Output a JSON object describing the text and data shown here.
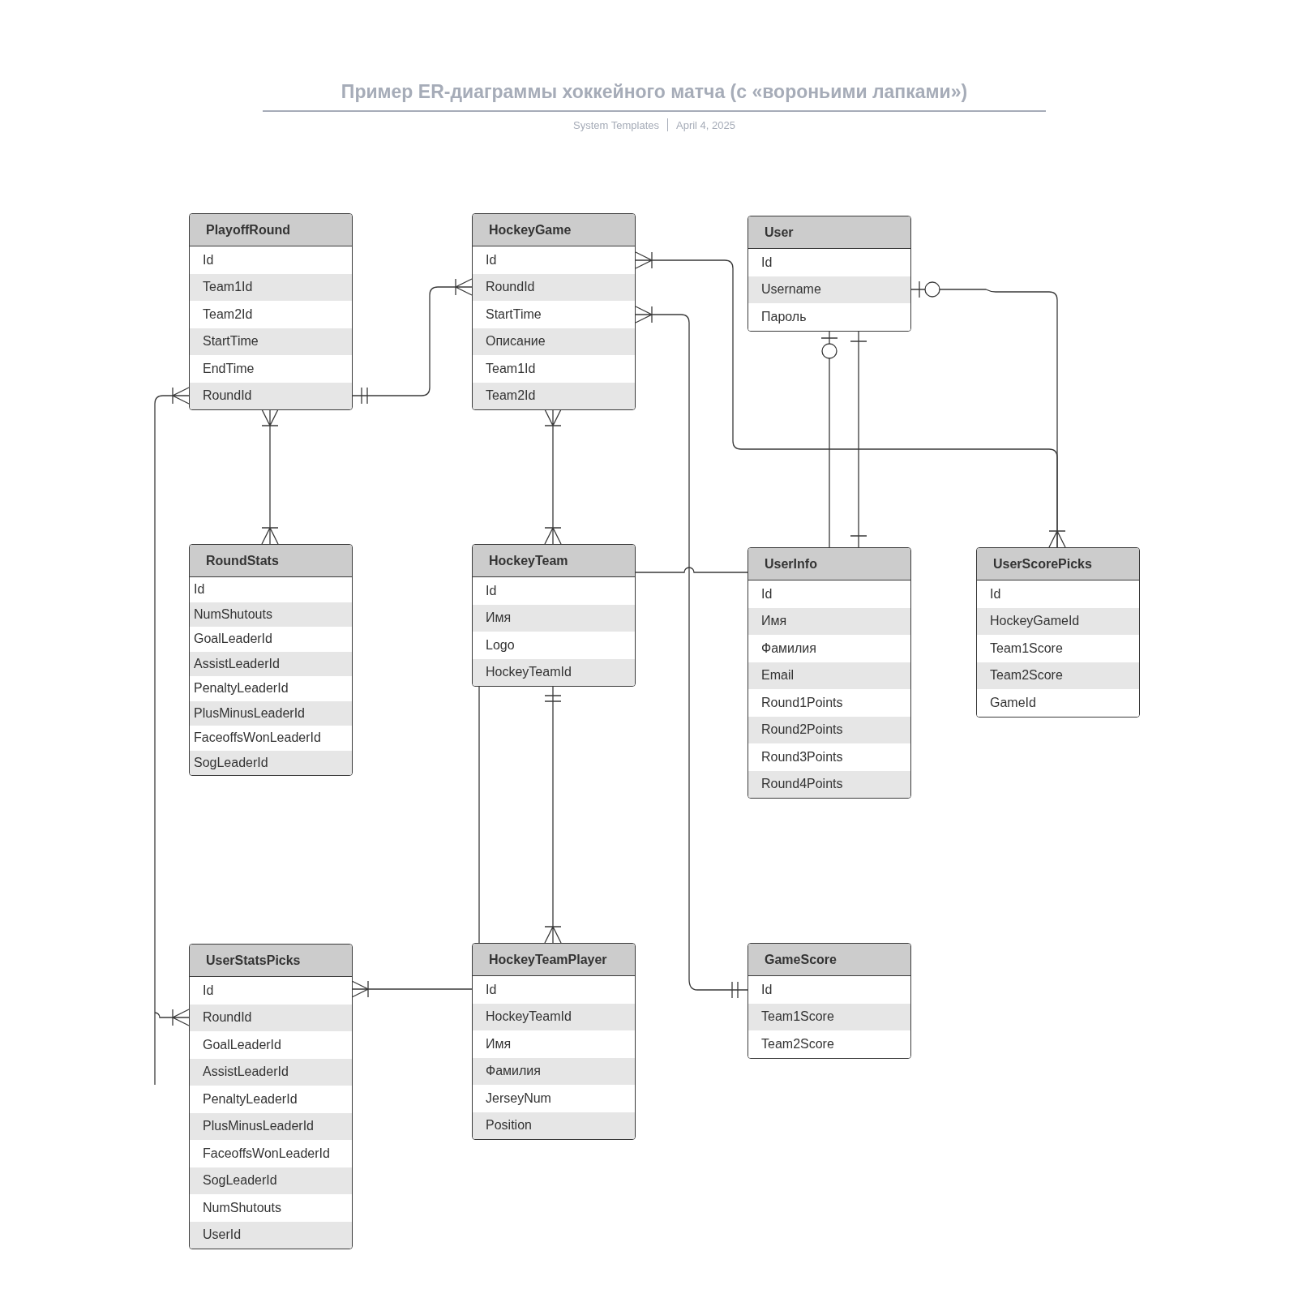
{
  "title": "Пример ER-диаграммы хоккейного матча (с «вороньими лапками»)",
  "subtitle": {
    "author": "System Templates",
    "date": "April 4, 2025"
  },
  "entities": [
    {
      "name": "PlayoffRound",
      "fields": [
        "Id",
        "Team1Id",
        "Team2Id",
        "StartTime",
        "EndTime",
        "RoundId"
      ]
    },
    {
      "name": "HockeyGame",
      "fields": [
        "Id",
        "RoundId",
        "StartTime",
        "Описание",
        "Team1Id",
        "Team2Id"
      ]
    },
    {
      "name": "User",
      "fields": [
        "Id",
        "Username",
        "Пароль"
      ]
    },
    {
      "name": "RoundStats",
      "fields": [
        "Id",
        "NumShutouts",
        "GoalLeaderId",
        "AssistLeaderId",
        "PenaltyLeaderId",
        "PlusMinusLeaderId",
        "FaceoffsWonLeaderId",
        "SogLeaderId"
      ]
    },
    {
      "name": "HockeyTeam",
      "fields": [
        "Id",
        "Имя",
        "Logo",
        "HockeyTeamId"
      ]
    },
    {
      "name": "UserInfo",
      "fields": [
        "Id",
        "Имя",
        "Фамилия",
        "Email",
        "Round1Points",
        "Round2Points",
        "Round3Points",
        "Round4Points"
      ]
    },
    {
      "name": "UserScorePicks",
      "fields": [
        "Id",
        "HockeyGameId",
        "Team1Score",
        "Team2Score",
        "GameId"
      ]
    },
    {
      "name": "UserStatsPicks",
      "fields": [
        "Id",
        "RoundId",
        "GoalLeaderId",
        "AssistLeaderId",
        "PenaltyLeaderId",
        "PlusMinusLeaderId",
        "FaceoffsWonLeaderId",
        "SogLeaderId",
        "NumShutouts",
        "UserId"
      ]
    },
    {
      "name": "HockeyTeamPlayer",
      "fields": [
        "Id",
        "HockeyTeamId",
        "Имя",
        "Фамилия",
        "JerseyNum",
        "Position"
      ]
    },
    {
      "name": "GameScore",
      "fields": [
        "Id",
        "Team1Score",
        "Team2Score"
      ]
    }
  ]
}
